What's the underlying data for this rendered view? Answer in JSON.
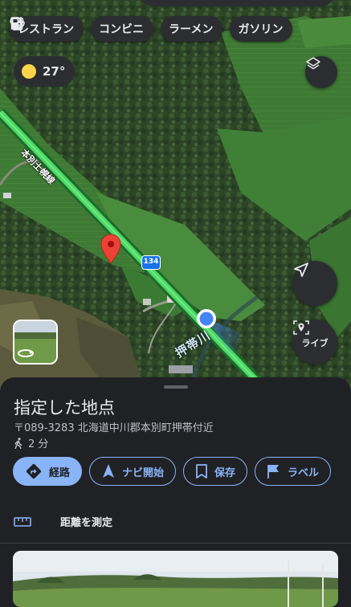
{
  "categories": [
    {
      "label": "レストラン",
      "icon": "utensils-icon"
    },
    {
      "label": "コンビニ",
      "icon": "store-icon"
    },
    {
      "label": "ラーメン",
      "icon": "ramen-bowl-icon"
    },
    {
      "label": "ガソリン",
      "icon": "gas-station-icon"
    }
  ],
  "weather": {
    "temperature": "27°",
    "icon": "sun-icon"
  },
  "map": {
    "road_name": "本別士幌線",
    "route_number": "134",
    "river_name": "押帯川",
    "marker": "red-pin-icon",
    "location": "blue-dot"
  },
  "live_button": {
    "label": "ライブ"
  },
  "place": {
    "title": "指定した地点",
    "address": "〒089-3283 北海道中川郡本別町押帯付近",
    "walk_time": "2 分"
  },
  "actions": [
    {
      "label": "経路",
      "icon": "directions-icon"
    },
    {
      "label": "ナビ開始",
      "icon": "navigation-arrow-icon"
    },
    {
      "label": "保存",
      "icon": "bookmark-icon"
    },
    {
      "label": "ラベル",
      "icon": "flag-icon"
    }
  ],
  "measure": {
    "label": "距離を測定",
    "icon": "ruler-icon"
  },
  "colors": {
    "accent": "#8ab4f8",
    "sheet": "#202124",
    "chip": "#2b2d30",
    "route": "#4cd964",
    "pin": "#ea4335",
    "location": "#4285f4"
  }
}
